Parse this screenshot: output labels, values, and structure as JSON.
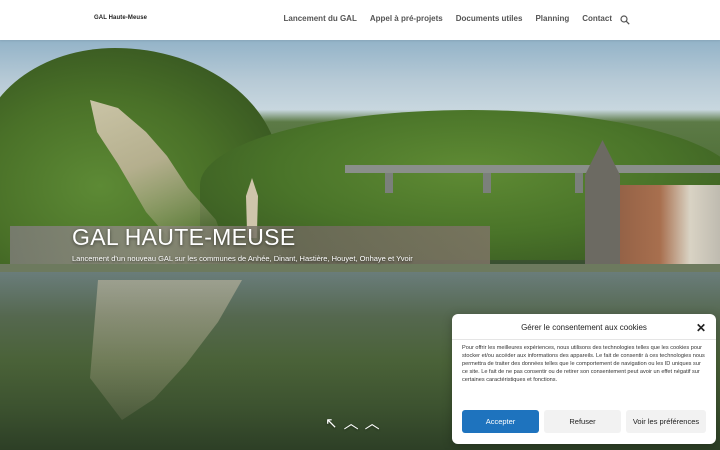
{
  "header": {
    "logo": "GAL Haute-Meuse",
    "nav": [
      {
        "label": "Lancement du GAL"
      },
      {
        "label": "Appel à pré-projets"
      },
      {
        "label": "Documents utiles"
      },
      {
        "label": "Planning"
      },
      {
        "label": "Contact"
      }
    ],
    "search_icon": "search-icon"
  },
  "hero": {
    "title": "GAL HAUTE-MEUSE",
    "subtitle": "Lancement d'un nouveau GAL sur les communes de Anhée, Dinant, Hastière, Houyet, Onhaye et Yvoir",
    "controls": [
      {
        "icon": "arrow-up-left-icon",
        "glyph": "↖"
      },
      {
        "icon": "chevron-up-icon",
        "glyph": "︿"
      },
      {
        "icon": "chevron-up-icon",
        "glyph": "︿"
      }
    ]
  },
  "consent": {
    "title": "Gérer le consentement aux cookies",
    "close_glyph": "✕",
    "text": "Pour offrir les meilleures expériences, nous utilisons des technologies telles que les cookies pour stocker et/ou accéder aux informations des appareils. Le fait de consentir à ces technologies nous permettra de traiter des données telles que le comportement de navigation ou les ID uniques sur ce site. Le fait de ne pas consentir ou de retirer son consentement peut avoir un effet négatif sur certaines caractéristiques et fonctions.",
    "buttons": {
      "accept": "Accepter",
      "refuse": "Refuser",
      "preferences": "Voir les préférences"
    },
    "accent_color": "#1e73be"
  }
}
